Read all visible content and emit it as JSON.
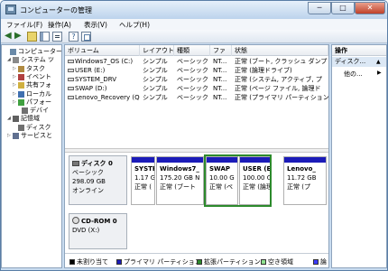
{
  "window": {
    "title": "コンピューターの管理",
    "min": "─",
    "max": "□",
    "close": "✕"
  },
  "menu": [
    "ファイル(F)",
    "操作(A)",
    "表示(V)",
    "ヘルプ(H)"
  ],
  "toolbar": {
    "back_icon": "arrow-left-icon",
    "forward_icon": "arrow-right-icon",
    "help_glyph": "?"
  },
  "tree": [
    {
      "label": "コンピューター",
      "icon": "computer-icon",
      "expander": "",
      "color": "#6a8aa8"
    },
    {
      "label": "システム ツ",
      "icon": "tools-icon",
      "expander": "◢",
      "color": "#8a8a8a"
    },
    {
      "label": "タスク",
      "icon": "clock-icon",
      "expander": "▷",
      "color": "#b08a40"
    },
    {
      "label": "イベント",
      "icon": "event-icon",
      "expander": "▷",
      "color": "#b04040"
    },
    {
      "label": "共有フォ",
      "icon": "folder-icon",
      "expander": "▷",
      "color": "#d0b040"
    },
    {
      "label": "ローカル",
      "icon": "users-icon",
      "expander": "▷",
      "color": "#4070b0"
    },
    {
      "label": "パフォー",
      "icon": "performance-icon",
      "expander": "▷",
      "color": "#40a040"
    },
    {
      "label": "デバイ",
      "icon": "device-icon",
      "expander": "",
      "color": "#707070"
    },
    {
      "label": "記憶域",
      "icon": "storage-icon",
      "expander": "◢",
      "color": "#606060"
    },
    {
      "label": "ディスク",
      "icon": "disk-icon",
      "expander": "",
      "color": "#707070"
    },
    {
      "label": "サービスと",
      "icon": "services-icon",
      "expander": "▷",
      "color": "#607090"
    }
  ],
  "volumes": {
    "headers": [
      "ボリューム",
      "レイアウト",
      "種類",
      "ファ",
      "状態"
    ],
    "rows": [
      [
        "Windows7_OS (C:)",
        "シンプル",
        "ベーシック",
        "NT...",
        "正常 (ブート, クラッシュ ダンプ"
      ],
      [
        "USER (E:)",
        "シンプル",
        "ベーシック",
        "NT...",
        "正常 (論理ドライブ)"
      ],
      [
        "SYSTEM_DRV",
        "シンプル",
        "ベーシック",
        "NT...",
        "正常 (システム, アクティブ, プ"
      ],
      [
        "SWAP (D:)",
        "シンプル",
        "ベーシック",
        "NT...",
        "正常 (ページ ファイル, 論理ド"
      ],
      [
        "Lenovo_Recovery (Q:)",
        "シンプル",
        "ベーシック",
        "NT...",
        "正常 (プライマリ パーティション"
      ]
    ]
  },
  "disk0": {
    "name": "ディスク 0",
    "type": "ベーシック",
    "size": "298.09 GB",
    "status": "オンライン",
    "partitions": [
      {
        "name": "SYSTE",
        "size": "1.17 G",
        "status": "正常 (",
        "bar": "#1b1bb8"
      },
      {
        "name": "Windows7_",
        "size": "175.20 GB N",
        "status": "正常 (ブート",
        "bar": "#1b1bb8"
      },
      {
        "name": "SWAP",
        "size": "10.00 G",
        "status": "正常 (ペ",
        "bar": "#1b1bb8"
      },
      {
        "name": "USER (E:",
        "size": "100.00 GB",
        "status": "正常 (論理",
        "bar": "#1b1bb8"
      },
      {
        "name": "Lenovo_",
        "size": "11.72 GB",
        "status": "正常 (プ",
        "bar": "#1b1bb8"
      }
    ]
  },
  "cdrom0": {
    "name": "CD-ROM 0",
    "type": "DVD (X:)"
  },
  "legend": [
    {
      "label": "未割り当て",
      "color": "#000000"
    },
    {
      "label": "プライマリ パーティション",
      "color": "#1b1bb8"
    },
    {
      "label": "拡張パーティション",
      "color": "#2c8a2c"
    },
    {
      "label": "空き領域",
      "color": "#8ee08e"
    },
    {
      "label": "論",
      "color": "#3a3aff"
    }
  ],
  "ops": {
    "title": "操作",
    "section": "ディスク...",
    "collapse": "▲",
    "more": "他の...",
    "more_caret": "▶"
  }
}
